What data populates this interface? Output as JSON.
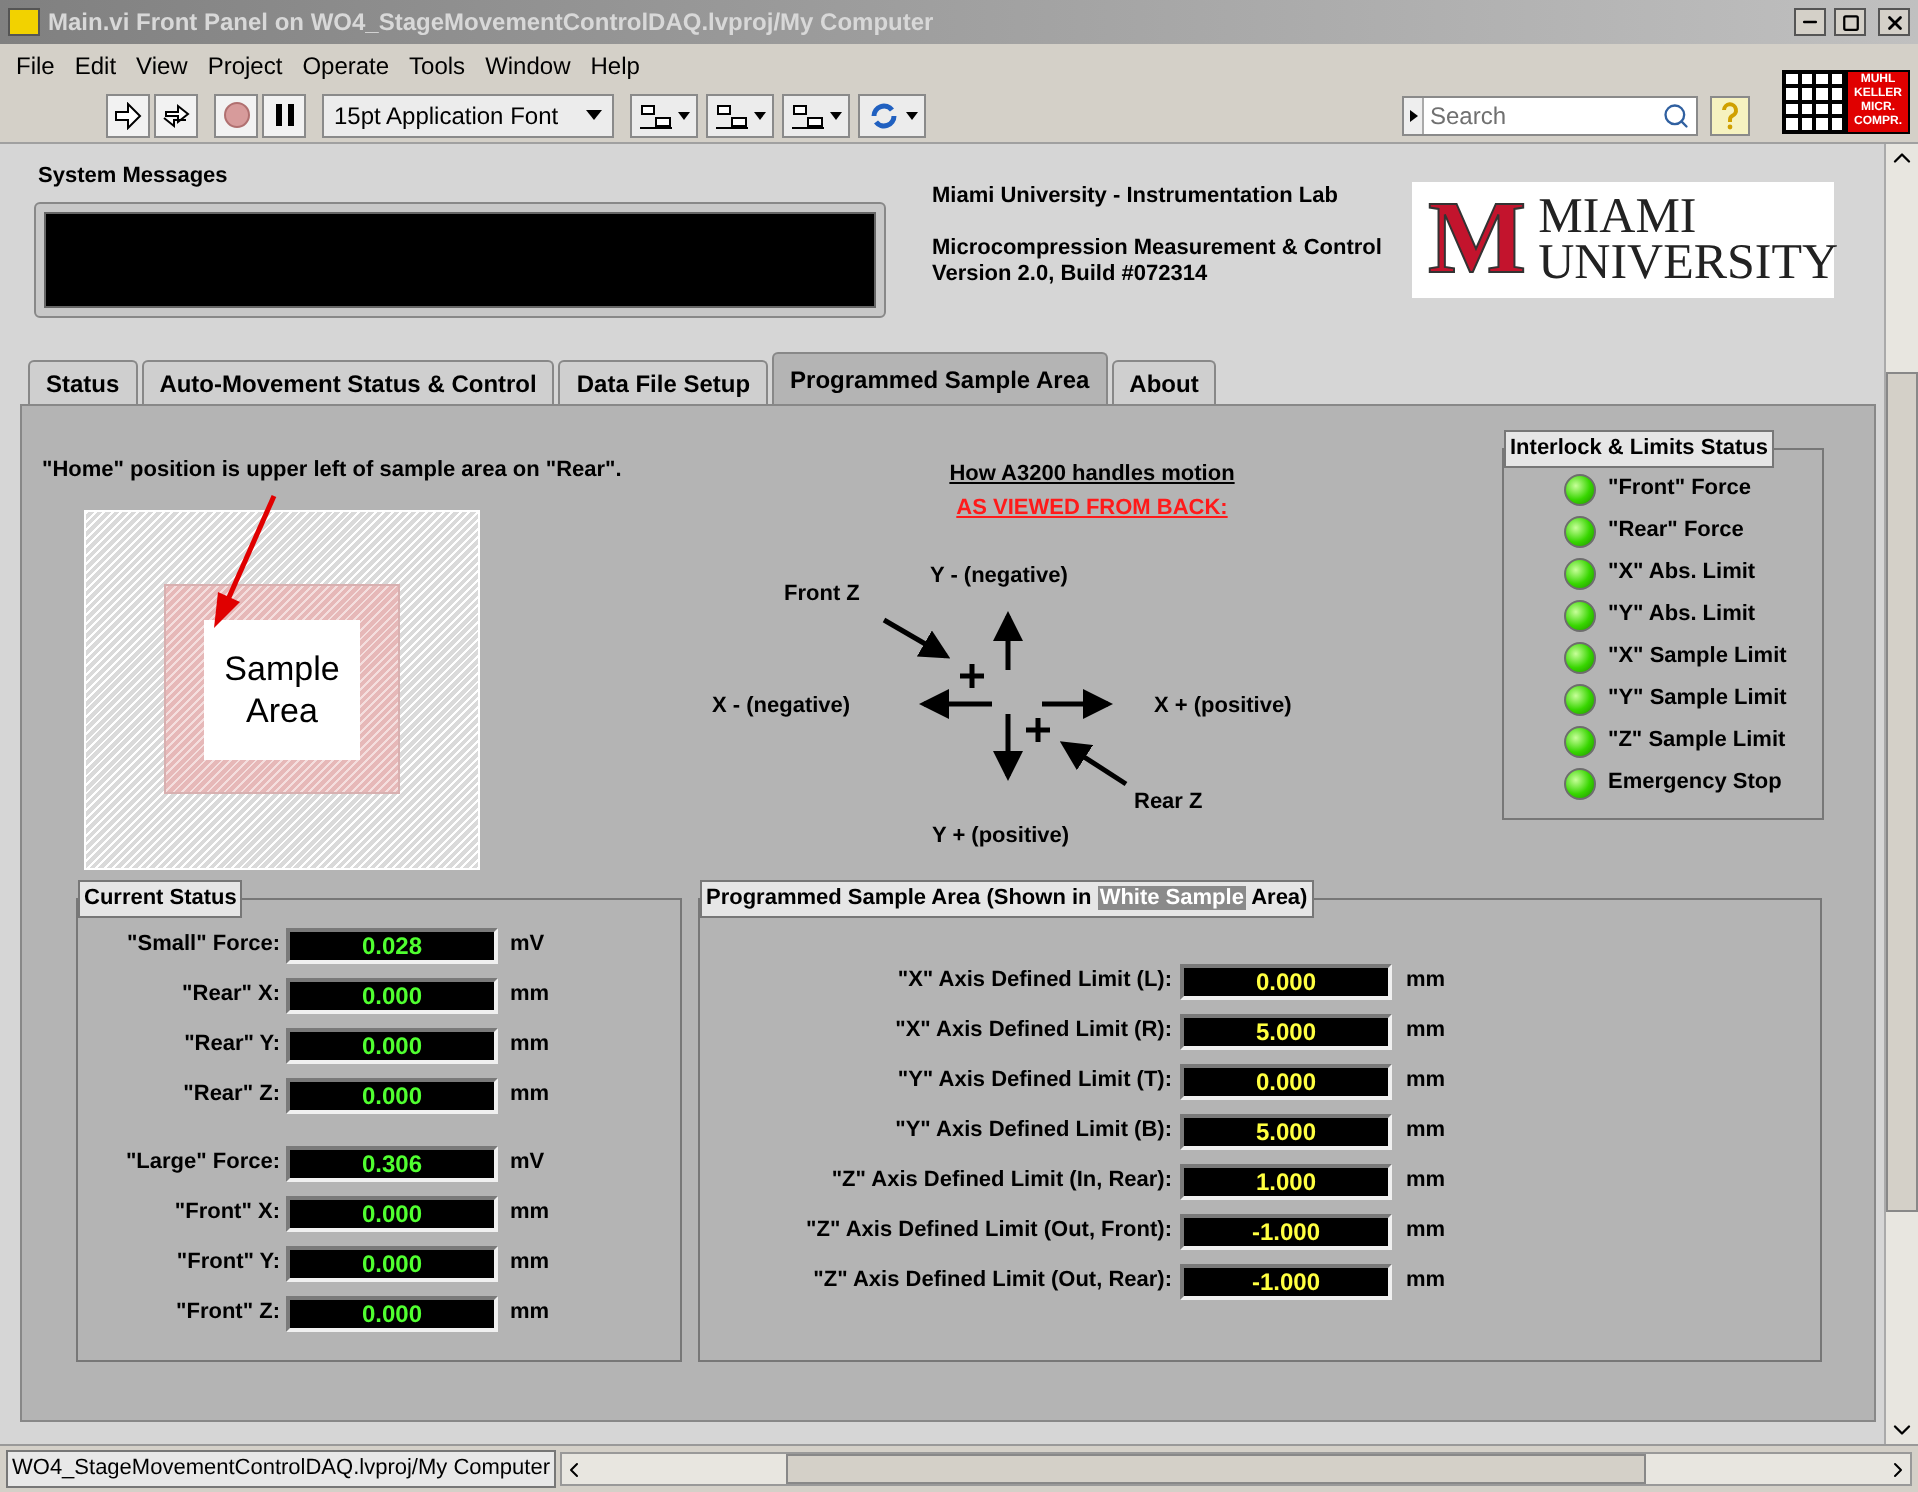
{
  "window": {
    "title": "Main.vi Front Panel on WO4_StageMovementControlDAQ.lvproj/My Computer"
  },
  "menu": [
    "File",
    "Edit",
    "View",
    "Project",
    "Operate",
    "Tools",
    "Window",
    "Help"
  ],
  "toolbar": {
    "abort": {
      "disabled": true
    },
    "font": "15pt Application Font",
    "search": {
      "placeholder": "Search"
    },
    "badge": [
      "MUHL",
      "KELLER",
      "MICR.",
      "COMPR."
    ]
  },
  "header": {
    "system_messages": {
      "label": "System Messages"
    },
    "lab": "Miami University - Instrumentation Lab",
    "app": "Microcompression Measurement & Control",
    "version": "Version 2.0, Build #072314",
    "logo": {
      "mark": "M",
      "lines": [
        "MIAMI",
        "UNIVERSITY"
      ]
    }
  },
  "tabs": [
    {
      "label": "Status",
      "selected": false
    },
    {
      "label": "Auto-Movement Status & Control",
      "selected": false
    },
    {
      "label": "Data File Setup",
      "selected": false
    },
    {
      "label": "Programmed Sample Area",
      "selected": true
    },
    {
      "label": "About",
      "selected": false
    }
  ],
  "panel": {
    "home_note": "\"Home\" position is upper left of sample area on \"Rear\".",
    "sample_area": "Sample Area",
    "motion": {
      "title": "How A3200 handles motion",
      "subtitle": "AS VIEWED FROM BACK:",
      "y_neg": "Y - (negative)",
      "front_z": "Front Z",
      "x_neg": "X - (negative)",
      "x_pos": "X + (positive)",
      "rear_z": "Rear Z",
      "y_pos": "Y + (positive)"
    },
    "interlock": {
      "title": "Interlock & Limits Status",
      "items": [
        {
          "label": "\"Front\" Force",
          "on": true
        },
        {
          "label": "\"Rear\" Force",
          "on": true
        },
        {
          "label": "\"X\" Abs. Limit",
          "on": true
        },
        {
          "label": "\"Y\" Abs. Limit",
          "on": true
        },
        {
          "label": "\"X\" Sample Limit",
          "on": true
        },
        {
          "label": "\"Y\" Sample Limit",
          "on": true
        },
        {
          "label": "\"Z\" Sample Limit",
          "on": true
        },
        {
          "label": "Emergency Stop",
          "on": true
        }
      ]
    },
    "current_status": {
      "title": "Current Status",
      "groups": [
        [
          {
            "label": "\"Small\" Force:",
            "value": "0.028",
            "unit": "mV"
          },
          {
            "label": "\"Rear\" X:",
            "value": "0.000",
            "unit": "mm"
          },
          {
            "label": "\"Rear\" Y:",
            "value": "0.000",
            "unit": "mm"
          },
          {
            "label": "\"Rear\" Z:",
            "value": "0.000",
            "unit": "mm"
          }
        ],
        [
          {
            "label": "\"Large\" Force:",
            "value": "0.306",
            "unit": "mV"
          },
          {
            "label": "\"Front\" X:",
            "value": "0.000",
            "unit": "mm"
          },
          {
            "label": "\"Front\" Y:",
            "value": "0.000",
            "unit": "mm"
          },
          {
            "label": "\"Front\" Z:",
            "value": "0.000",
            "unit": "mm"
          }
        ]
      ]
    },
    "programmed": {
      "title_before": "Programmed Sample Area (Shown in",
      "title_highlight": "White Sample",
      "title_after": "Area)",
      "rows": [
        {
          "label": "\"X\" Axis Defined Limit (L):",
          "value": "0.000",
          "unit": "mm"
        },
        {
          "label": "\"X\" Axis Defined Limit (R):",
          "value": "5.000",
          "unit": "mm"
        },
        {
          "label": "\"Y\" Axis Defined Limit (T):",
          "value": "0.000",
          "unit": "mm"
        },
        {
          "label": "\"Y\" Axis Defined Limit (B):",
          "value": "5.000",
          "unit": "mm"
        },
        {
          "label": "\"Z\" Axis Defined Limit (In, Rear):",
          "value": "1.000",
          "unit": "mm"
        },
        {
          "label": "\"Z\" Axis Defined Limit (Out, Front):",
          "value": "-1.000",
          "unit": "mm"
        },
        {
          "label": "\"Z\" Axis Defined Limit (Out, Rear):",
          "value": "-1.000",
          "unit": "mm"
        }
      ]
    }
  },
  "status_bar": "WO4_StageMovementControlDAQ.lvproj/My Computer"
}
